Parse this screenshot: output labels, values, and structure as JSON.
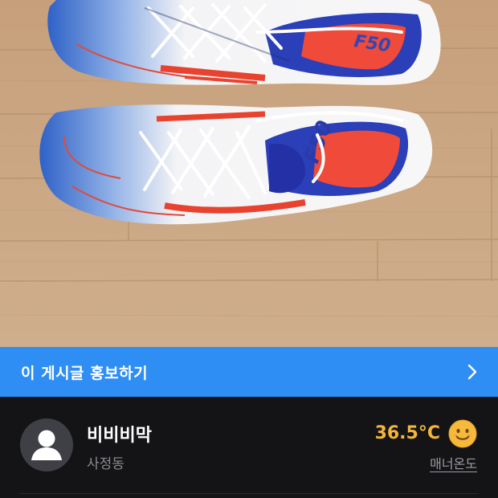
{
  "promo_banner": {
    "label": "이 게시글 홍보하기"
  },
  "seller": {
    "name": "비비비막",
    "location": "사정동",
    "manner_temperature": "36.5°C",
    "manner_temperature_link": "매너온도"
  },
  "colors": {
    "promo_background": "#2f8ef3",
    "temperature_accent": "#f3b53a",
    "page_background": "#141416"
  },
  "icons": {
    "promo_arrow": "chevron-right-icon",
    "avatar": "user-avatar-icon",
    "temperature_face": "smiling-face-emoji"
  }
}
